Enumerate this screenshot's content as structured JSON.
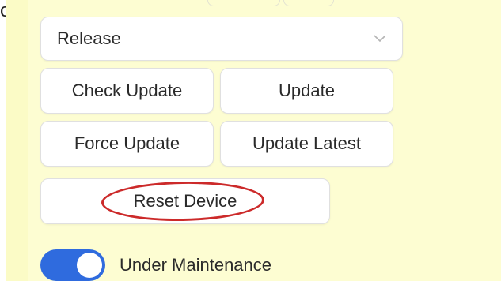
{
  "edge_text": "c",
  "release_select": {
    "value": "Release",
    "icon": "chevron-down-icon"
  },
  "buttons": {
    "check_update": "Check Update",
    "update": "Update",
    "force_update": "Force Update",
    "update_latest": "Update Latest",
    "reset_device": "Reset Device"
  },
  "maintenance_toggle": {
    "label": "Under Maintenance",
    "state": "on"
  },
  "colors": {
    "panel_background": "#fdfdd2",
    "toggle_on": "#2f6bde",
    "annotation_ring": "#cc2a2a"
  }
}
